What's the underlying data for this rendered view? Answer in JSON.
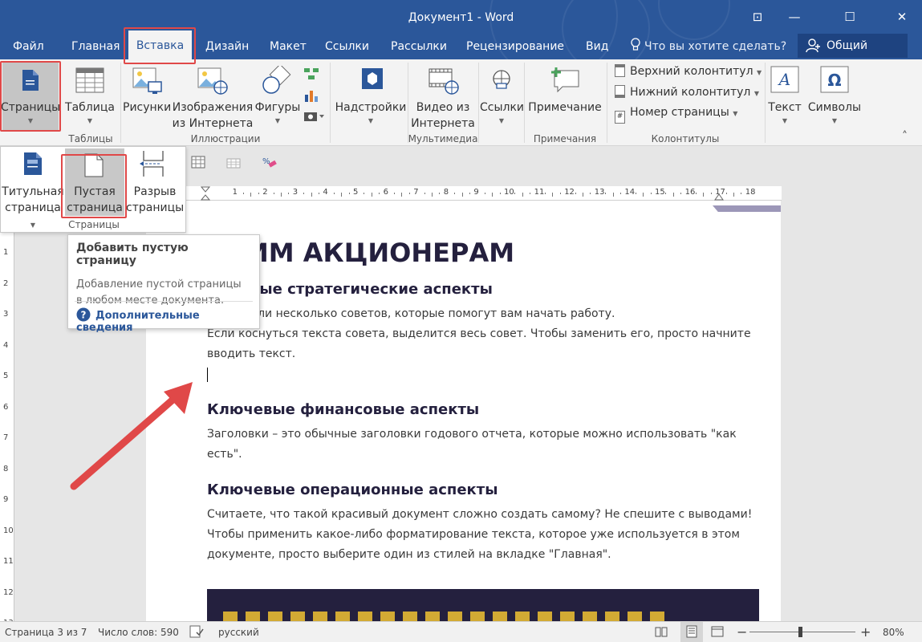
{
  "window": {
    "title": "Документ1 - Word",
    "controls": {
      "ribbon_display": "⊡",
      "minimize": "—",
      "maximize": "☐",
      "close": "✕"
    }
  },
  "tabs": [
    "Файл",
    "Главная",
    "Вставка",
    "Дизайн",
    "Макет",
    "Ссылки",
    "Рассылки",
    "Рецензирование",
    "Вид"
  ],
  "active_tab": "Вставка",
  "tell_me": "Что вы хотите сделать?",
  "share": "Общий доступ",
  "ribbon": {
    "pages": "Страницы",
    "table": "Таблица",
    "tables_group": "Таблицы",
    "pictures": "Рисунки",
    "online_pictures": [
      "Изображения",
      "из Интернета"
    ],
    "shapes": "Фигуры",
    "illustrations_group": "Иллюстрации",
    "addins": "Надстройки",
    "online_video": [
      "Видео из",
      "Интернета"
    ],
    "media_group": "Мультимедиа",
    "links": "Ссылки",
    "comment": "Примечание",
    "comments_group": "Примечания",
    "header": "Верхний колонтитул",
    "footer": "Нижний колонтитул",
    "page_number": "Номер страницы",
    "hf_group": "Колонтитулы",
    "text": "Текст",
    "symbols": "Символы",
    "collapse": "˄"
  },
  "pages_dropdown": {
    "cover": [
      "Титульная",
      "страница"
    ],
    "blank": [
      "Пустая",
      "страница"
    ],
    "page_break": [
      "Разрыв",
      "страницы"
    ],
    "group_label": "Страницы"
  },
  "tooltip": {
    "title": "Добавить пустую страницу",
    "body_1": "Добавление пустой страницы",
    "body_2": "в любом месте документа.",
    "more_info": "Дополнительные сведения"
  },
  "ruler": {
    "h_labels": [
      "1",
      "2",
      "3",
      "4",
      "5",
      "6",
      "7",
      "8",
      "9",
      "10",
      "11",
      "12",
      "13",
      "14",
      "15",
      "16",
      "17",
      "18"
    ],
    "v_labels": [
      "1",
      "2",
      "3",
      "4",
      "5",
      "6",
      "7",
      "8",
      "9",
      "10",
      "11",
      "12",
      "13"
    ]
  },
  "document": {
    "title_fragment": "ИМ АКЦИОНЕРАМ",
    "h2_1_fragment": "вые стратегические аспекты",
    "p1_fragment": "или несколько советов, которые помогут вам начать работу.",
    "p2_line1": "Если коснуться текста совета, выделится весь совет. Чтобы заменить его, просто начните",
    "p2_line2": "вводить текст.",
    "h2_2": "Ключевые финансовые аспекты",
    "p3_line1": "Заголовки – это обычные заголовки годового отчета, которые можно использовать \"как",
    "p3_line2": "есть\".",
    "h2_3": "Ключевые операционные аспекты",
    "p4_line1": "Считаете, что такой красивый документ сложно создать самому? Не спешите с выводами!",
    "p4_line2": "Чтобы применить какое-либо форматирование текста, которое уже используется в этом",
    "p4_line3": "документе, просто выберите один из стилей на вкладке \"Главная\"."
  },
  "status": {
    "page": "Страница 3 из 7",
    "words": "Число слов: 590",
    "language": "русский",
    "zoom_minus": "−",
    "zoom_plus": "+",
    "zoom": "80%"
  },
  "colors": {
    "brand": "#2b579a",
    "highlight": "#e04848",
    "doc_banner": "#24203e",
    "doc_accent": "#9c97b8"
  }
}
